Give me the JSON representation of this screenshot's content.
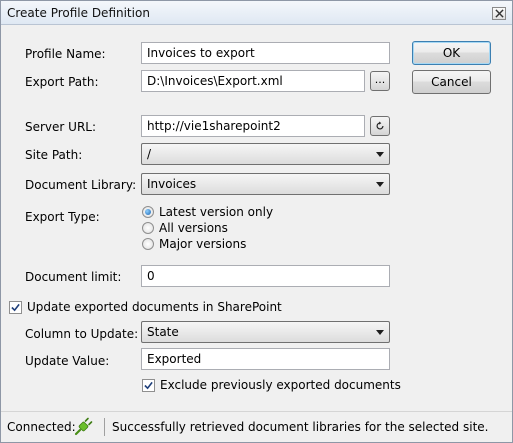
{
  "window": {
    "title": "Create Profile Definition"
  },
  "buttons": {
    "ok": "OK",
    "cancel": "Cancel",
    "browse": "...",
    "refresh_icon": "refresh-icon"
  },
  "form": {
    "profile_name": {
      "label": "Profile Name:",
      "value": "Invoices to export"
    },
    "export_path": {
      "label": "Export Path:",
      "value": "D:\\Invoices\\Export.xml"
    },
    "server_url": {
      "label": "Server URL:",
      "value": "http://vie1sharepoint2"
    },
    "site_path": {
      "label": "Site Path:",
      "value": "/"
    },
    "document_library": {
      "label": "Document Library:",
      "value": "Invoices"
    },
    "export_type": {
      "label": "Export Type:",
      "options": [
        "Latest version only",
        "All versions",
        "Major versions"
      ],
      "selected": "Latest version only"
    },
    "document_limit": {
      "label": "Document limit:",
      "value": "0"
    },
    "update_in_sharepoint": {
      "label": "Update exported documents in SharePoint",
      "checked": true
    },
    "column_to_update": {
      "label": "Column to Update:",
      "value": "State"
    },
    "update_value": {
      "label": "Update Value:",
      "value": "Exported"
    },
    "exclude_previous": {
      "label": "Exclude previously exported documents",
      "checked": true
    }
  },
  "status": {
    "connected_label": "Connected:",
    "connection_icon": "plug-icon",
    "message": "Successfully retrieved document libraries for the selected site."
  },
  "colors": {
    "plug": "#6abf2a",
    "radio_selected": "#1a63b0",
    "default_button_border": "#3c7fb1"
  }
}
